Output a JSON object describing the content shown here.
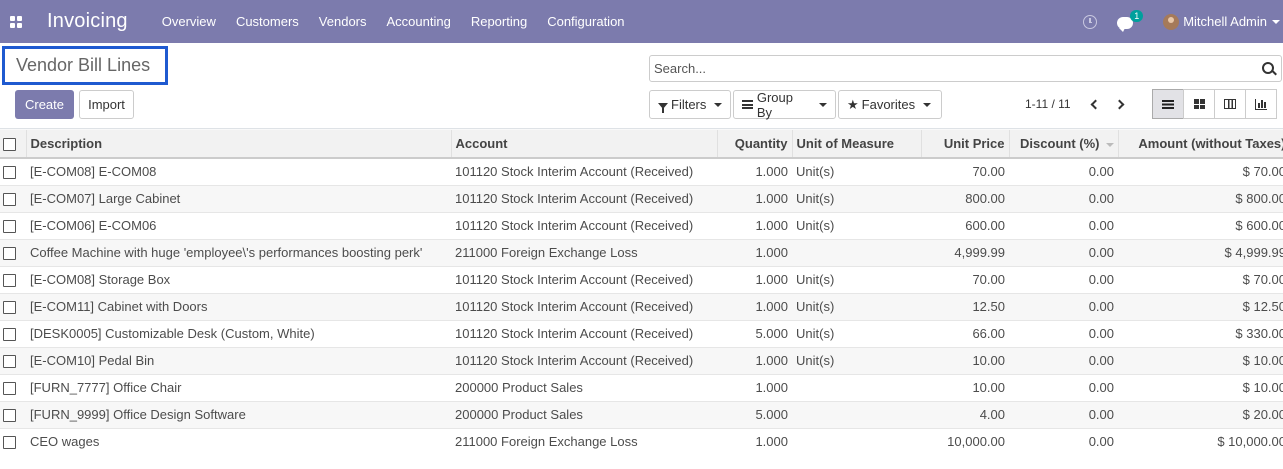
{
  "navbar": {
    "app_name": "Invoicing",
    "menu": [
      "Overview",
      "Customers",
      "Vendors",
      "Accounting",
      "Reporting",
      "Configuration"
    ],
    "chat_badge": "1",
    "user_name": "Mitchell Admin",
    "bg_color": "#7c7bad"
  },
  "control_panel": {
    "breadcrumb": "Vendor Bill Lines",
    "create_label": "Create",
    "import_label": "Import",
    "search_placeholder": "Search...",
    "filters_label": "Filters",
    "group_by_label": "Group By",
    "favorites_label": "Favorites",
    "pager": "1-11 / 11",
    "views": [
      "list-view",
      "kanban-view",
      "pivot-view",
      "graph-view"
    ],
    "active_view": "list-view"
  },
  "table": {
    "columns": [
      "Description",
      "Account",
      "Quantity",
      "Unit of Measure",
      "Unit Price",
      "Discount (%)",
      "Amount (without Taxes)"
    ],
    "rows": [
      [
        "[E-COM08] E-COM08",
        "101120 Stock Interim Account (Received)",
        "1.000",
        "Unit(s)",
        "70.00",
        "0.00",
        "$ 70.00"
      ],
      [
        "[E-COM07] Large Cabinet",
        "101120 Stock Interim Account (Received)",
        "1.000",
        "Unit(s)",
        "800.00",
        "0.00",
        "$ 800.00"
      ],
      [
        "[E-COM06] E-COM06",
        "101120 Stock Interim Account (Received)",
        "1.000",
        "Unit(s)",
        "600.00",
        "0.00",
        "$ 600.00"
      ],
      [
        "Coffee Machine with huge 'employee\\'s performances boosting perk'",
        "211000 Foreign Exchange Loss",
        "1.000",
        "",
        "4,999.99",
        "0.00",
        "$ 4,999.99"
      ],
      [
        "[E-COM08] Storage Box",
        "101120 Stock Interim Account (Received)",
        "1.000",
        "Unit(s)",
        "70.00",
        "0.00",
        "$ 70.00"
      ],
      [
        "[E-COM11] Cabinet with Doors",
        "101120 Stock Interim Account (Received)",
        "1.000",
        "Unit(s)",
        "12.50",
        "0.00",
        "$ 12.50"
      ],
      [
        "[DESK0005] Customizable Desk (Custom, White)",
        "101120 Stock Interim Account (Received)",
        "5.000",
        "Unit(s)",
        "66.00",
        "0.00",
        "$ 330.00"
      ],
      [
        "[E-COM10] Pedal Bin",
        "101120 Stock Interim Account (Received)",
        "1.000",
        "Unit(s)",
        "10.00",
        "0.00",
        "$ 10.00"
      ],
      [
        "[FURN_7777] Office Chair",
        "200000 Product Sales",
        "1.000",
        "",
        "10.00",
        "0.00",
        "$ 10.00"
      ],
      [
        "[FURN_9999] Office Design Software",
        "200000 Product Sales",
        "5.000",
        "",
        "4.00",
        "0.00",
        "$ 20.00"
      ],
      [
        "CEO wages",
        "211000 Foreign Exchange Loss",
        "1.000",
        "",
        "10,000.00",
        "0.00",
        "$ 10,000.00"
      ]
    ]
  }
}
